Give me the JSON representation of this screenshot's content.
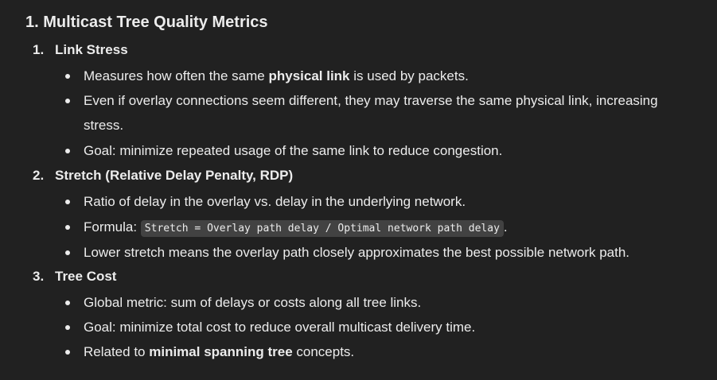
{
  "heading": "1. Multicast Tree Quality Metrics",
  "sections": [
    {
      "number": "1.",
      "title": "Link Stress",
      "bullets": [
        {
          "before": "Measures how often the same ",
          "bold": "physical link",
          "after": " is used by packets."
        },
        {
          "line1": "Even if overlay connections seem different, they may traverse the same physical link, increasing",
          "line2": "stress."
        },
        {
          "text": "Goal: minimize repeated usage of the same link to reduce congestion."
        }
      ]
    },
    {
      "number": "2.",
      "title": "Stretch (Relative Delay Penalty, RDP)",
      "bullets": [
        {
          "text": "Ratio of delay in the overlay vs. delay in the underlying network."
        },
        {
          "before": "Formula: ",
          "code": "Stretch = Overlay path delay / Optimal network path delay",
          "after": "."
        },
        {
          "text": "Lower stretch means the overlay path closely approximates the best possible network path."
        }
      ]
    },
    {
      "number": "3.",
      "title": "Tree Cost",
      "bullets": [
        {
          "text": "Global metric: sum of delays or costs along all tree links."
        },
        {
          "text": "Goal: minimize total cost to reduce overall multicast delivery time."
        },
        {
          "before": "Related to ",
          "bold": "minimal spanning tree",
          "after": " concepts."
        }
      ]
    }
  ]
}
